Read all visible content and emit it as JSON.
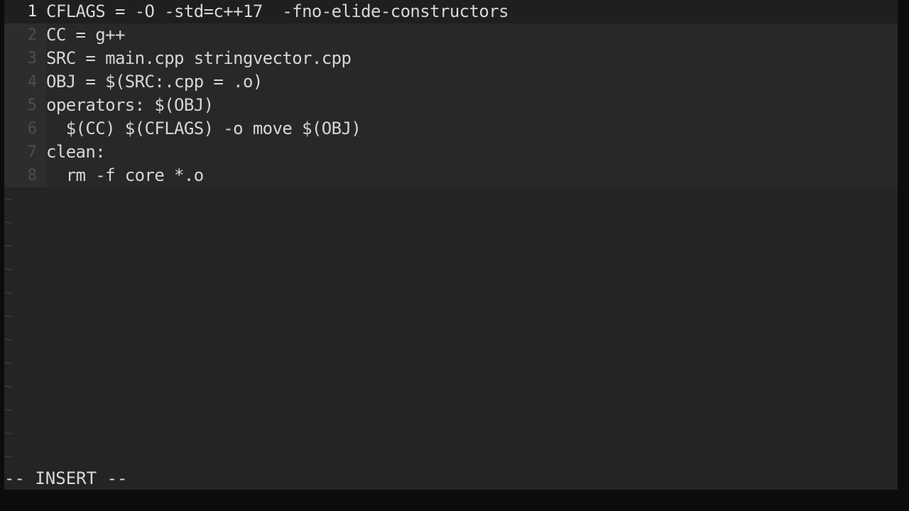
{
  "editor": {
    "lines": [
      {
        "number": "1",
        "text": "CFLAGS = -O -std=c++17  -fno-elide-constructors"
      },
      {
        "number": "2",
        "text": "CC = g++"
      },
      {
        "number": "3",
        "text": "SRC = main.cpp stringvector.cpp"
      },
      {
        "number": "4",
        "text": "OBJ = $(SRC:.cpp = .o)"
      },
      {
        "number": "5",
        "text": "operators: $(OBJ)"
      },
      {
        "number": "6",
        "text": "  $(CC) $(CFLAGS) -o move $(OBJ)"
      },
      {
        "number": "7",
        "text": "clean:"
      },
      {
        "number": "8",
        "text": "  rm -f core *.o"
      }
    ],
    "empty_line_marker": "~",
    "mode": "-- INSERT --"
  }
}
